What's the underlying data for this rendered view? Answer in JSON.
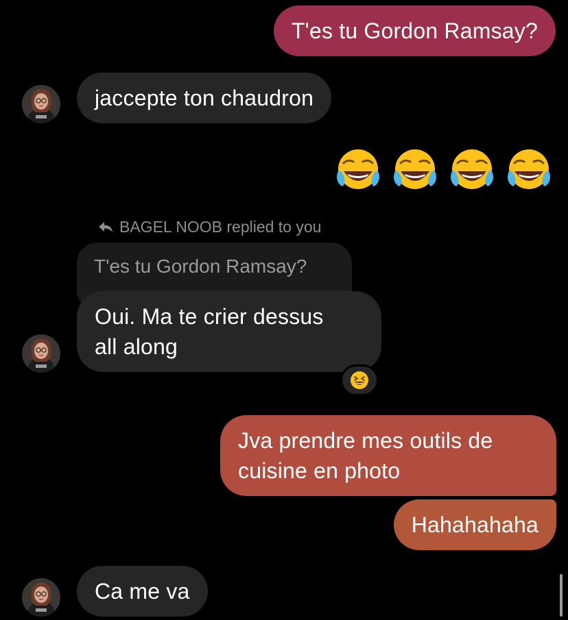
{
  "conversation": {
    "messages": [
      {
        "text": "T'es tu Gordon Ramsay?",
        "direction": "outgoing"
      },
      {
        "text": "jaccepte ton chaudron",
        "direction": "incoming"
      },
      {
        "text": "",
        "direction": "outgoing",
        "emoji": "face-with-tears-of-joy",
        "count": 4
      },
      {
        "text": "Oui. Ma te crier dessus all along",
        "direction": "incoming"
      },
      {
        "text": "Jva prendre mes outils de cuisine en photo",
        "direction": "outgoing"
      },
      {
        "text": "Hahahahaha",
        "direction": "outgoing"
      },
      {
        "text": "Ca me va",
        "direction": "incoming"
      }
    ],
    "reply": {
      "label": "BAGEL NOOB replied to you",
      "quoted_text": "T'es tu Gordon Ramsay?",
      "line1": "Oui. Ma te crier dessus",
      "line2": "all along",
      "reaction_emoji": "grinning-squinting-face"
    },
    "outgoing_photo_msg": {
      "line1": "Jva prendre mes outils de",
      "line2": "cuisine en photo"
    }
  },
  "colors": {
    "background": "#000000",
    "incoming_bubble": "#262626",
    "quoted_bubble": "#1b1b1b",
    "outgoing_bubble_1": "#9c2f4b",
    "outgoing_bubble_2": "#b04d3e",
    "outgoing_bubble_3": "#b3573a",
    "secondary_text": "#8e8e8e"
  },
  "icons": {
    "reply_arrow": "reply-arrow-icon",
    "avatar": "contact-avatar"
  }
}
